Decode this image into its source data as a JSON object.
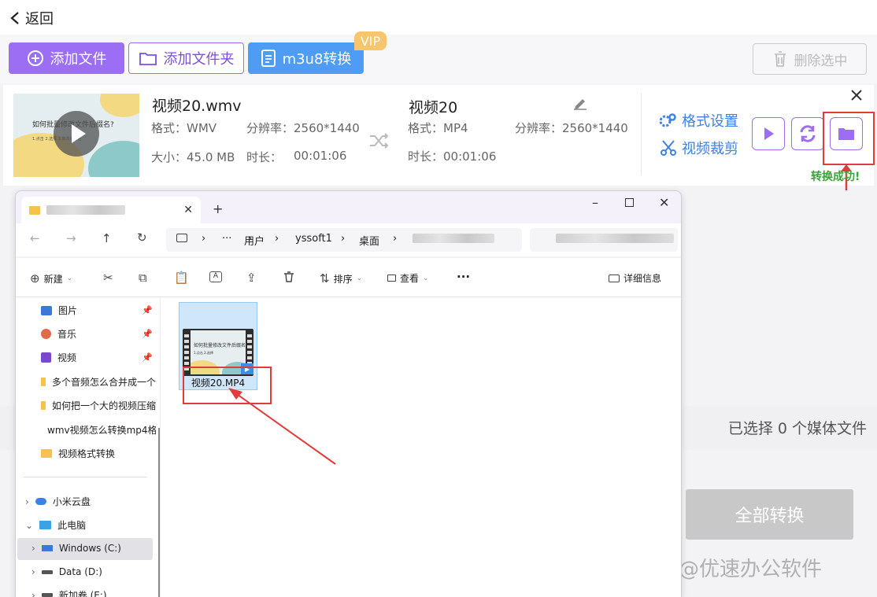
{
  "topbar": {
    "back_label": "返回"
  },
  "toolbar": {
    "add_file": "添加文件",
    "add_folder": "添加文件夹",
    "m3u8": "m3u8转换",
    "vip": "VIP",
    "delete_selected": "删除选中"
  },
  "file": {
    "thumb_title": "如何批量修改文件后缀名?",
    "thumb_sub": "1.点击 2.选择 3.修改后缀名",
    "src_name": "视频20.wmv",
    "src_format": "格式：WMV",
    "src_resolution": "分辨率：2560*1440",
    "src_size": "大小：45.0 MB",
    "src_duration_label": "时长：",
    "src_duration": "00:01:06",
    "dst_name": "视频20",
    "dst_format": "格式：MP4",
    "dst_resolution": "分辨率：2560*1440",
    "dst_duration": "时长：00:01:06",
    "format_settings": "格式设置",
    "video_crop": "视频裁剪",
    "success": "转换成功!"
  },
  "status": {
    "selected_count": "已选择 0 个媒体文件"
  },
  "convert_all": "全部转换",
  "watermark": "@优速办公软件",
  "explorer": {
    "crumbs": [
      "···",
      "用户",
      "yssoft1",
      "桌面"
    ],
    "commands": {
      "new": "新建",
      "sort": "排序",
      "view": "查看",
      "more": "···",
      "details": "详细信息"
    },
    "quick": [
      {
        "label": "图片",
        "icon": "pictures-icon"
      },
      {
        "label": "音乐",
        "icon": "music-icon"
      },
      {
        "label": "视频",
        "icon": "videos-icon"
      }
    ],
    "folders": [
      "多个音频怎么合并成一个",
      "如何把一个大的视频压缩",
      "wmv视频怎么转换mp4格",
      "视频格式转换"
    ],
    "tree": {
      "xiaomi": "小米云盘",
      "pc": "此电脑",
      "c": "Windows (C:)",
      "d": "Data (D:)",
      "e": "新加卷 (E:)"
    },
    "file_name": "视频20.MP4",
    "thumb_text": "如何批量修改文件后缀名?",
    "thumb_sub": "1.点击 2.选择"
  },
  "colors": {
    "purple": "#9b6ef3",
    "blue": "#4f9cf5",
    "red": "#e23b3b",
    "green": "#3ea23a"
  }
}
